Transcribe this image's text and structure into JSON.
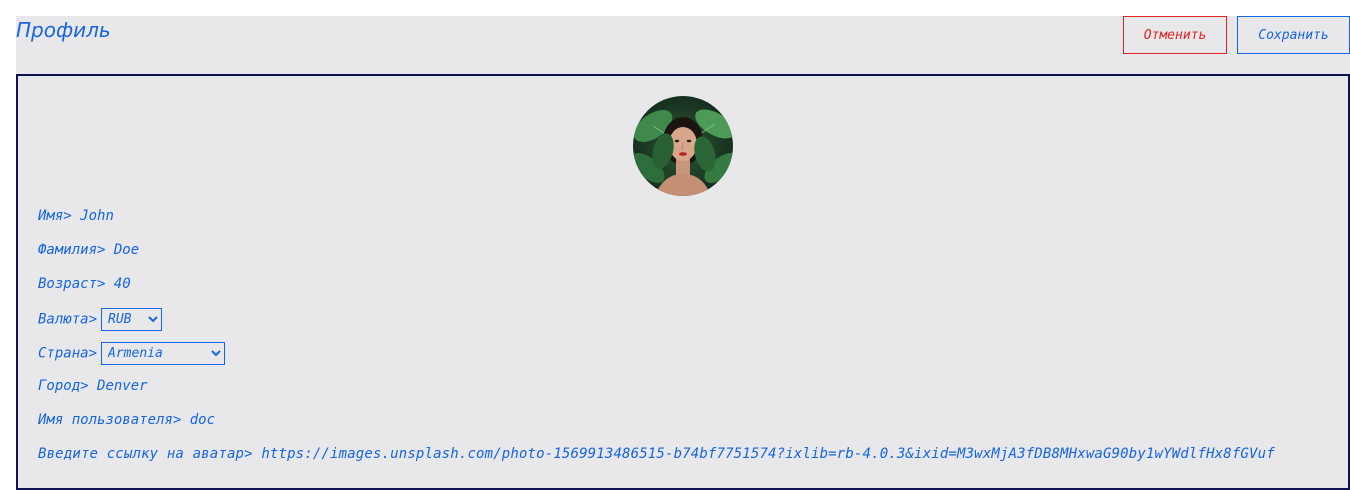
{
  "header": {
    "title": "Профиль",
    "cancel_label": "Отменить",
    "save_label": "Сохранить"
  },
  "profile": {
    "first_name": {
      "label": "Имя>",
      "value": "John"
    },
    "last_name": {
      "label": "Фамилия>",
      "value": "Doe"
    },
    "age": {
      "label": "Возраст>",
      "value": "40"
    },
    "currency": {
      "label": "Валюта>",
      "selected": "RUB"
    },
    "country": {
      "label": "Страна>",
      "selected": "Armenia"
    },
    "city": {
      "label": "Город>",
      "value": "Denver"
    },
    "username": {
      "label": "Имя пользователя>",
      "value": "doc"
    },
    "avatar_url": {
      "label": "Введите ссылку на аватар>",
      "value": "https://images.unsplash.com/photo-1569913486515-b74bf7751574?ixlib=rb-4.0.3&ixid=M3wxMjA3fDB8MHxwaG90by1wYWdlfHx8fGVuf"
    }
  },
  "colors": {
    "accent": "#1565e0",
    "danger": "#e02424",
    "card_border": "#0f1450",
    "background": "#e8e8ea"
  }
}
